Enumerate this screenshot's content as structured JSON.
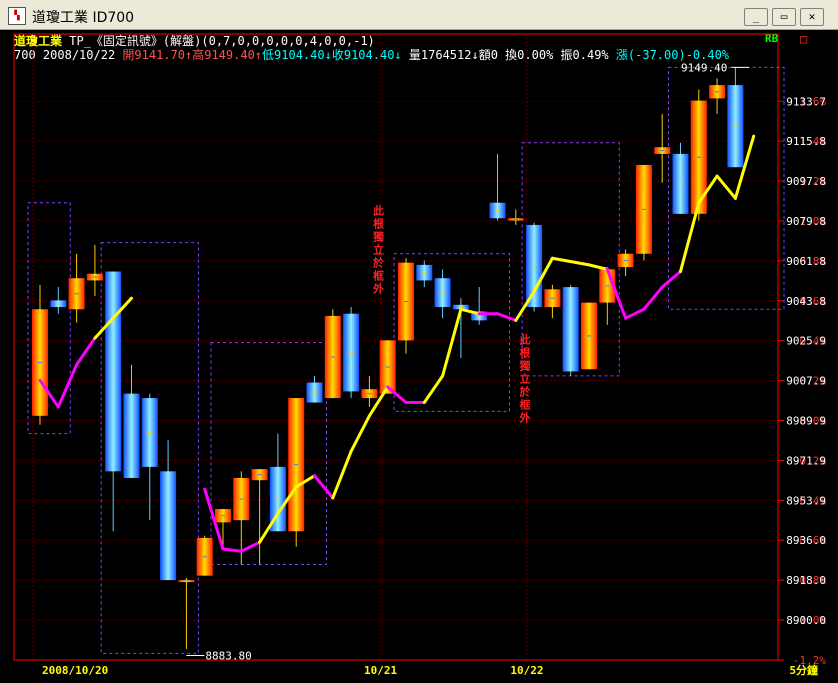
{
  "window": {
    "title": "道瓊工業 ID700",
    "icon": "chart-app-icon",
    "buttons": {
      "minimize": "_",
      "restore": "▭",
      "close": "✕"
    }
  },
  "header": {
    "name": "道瓊工業",
    "formula": "TP_《固定訊號》(解盤)(0,7,0,0,0,0,0,4,0,0,-1)",
    "code": "700",
    "date": "2008/10/22",
    "open": "開9141.70↑",
    "high": "高9149.40↑",
    "low": "低9104.40↓",
    "close": "收9104.40↓",
    "volume": "量1764512↓",
    "amount": "額0",
    "turnover": "換0.00%",
    "amplitude": "振0.49%",
    "change": "漲(-37.00)-0.40%",
    "rb_label": "RB",
    "box_label": "□"
  },
  "colors": {
    "up_outer": "#ff3000",
    "up_inner": "#ffcc00",
    "down_outer": "#1060ff",
    "down_inner": "#80e0ff",
    "line_up": "#ffff00",
    "line_down": "#ff00ff",
    "box": "#8040ff",
    "grid": "#800000",
    "axis": "#ff0000"
  },
  "chart_data": {
    "type": "candlestick",
    "interval": "5分鐘",
    "ylim": [
      8882,
      9155
    ],
    "y_ticks_price": [
      "9133.7",
      "9115.8",
      "9097.8",
      "9079.8",
      "9061.8",
      "9043.8",
      "9025.9",
      "9007.9",
      "8989.9",
      "8971.9",
      "8953.9",
      "8936.0",
      "8918.0",
      "8900.0"
    ],
    "y_ticks_pct": [
      "1.6%",
      "1.4%",
      "1.2%",
      "1.0%",
      "0.8%",
      "0.6%",
      "0.4%",
      "0.2%",
      "0.0%",
      "-0.2%",
      "-0.4%",
      "-0.6%",
      "-0.8%",
      "-1.0%",
      "-1.2%"
    ],
    "y_pct_values": [
      1.6,
      1.4,
      1.2,
      1.0,
      0.8,
      0.6,
      0.4,
      0.2,
      0.0,
      -0.2,
      -0.4,
      -0.6,
      -0.8,
      -1.0,
      -1.2
    ],
    "y_price_values": [
      9133.7,
      9115.8,
      9097.8,
      9079.8,
      9061.8,
      9043.8,
      9025.9,
      9007.9,
      8989.9,
      8971.9,
      8953.9,
      8936.0,
      8918.0,
      8900.0
    ],
    "base_price": 8989.9,
    "x_labels": [
      {
        "label": "2008/10/20",
        "index": 0
      },
      {
        "label": "10/21",
        "index": 19
      },
      {
        "label": "10/22",
        "index": 27
      }
    ],
    "candles": [
      {
        "o": 8992,
        "h": 9051,
        "l": 8988,
        "c": 9040
      },
      {
        "o": 9044,
        "h": 9050,
        "l": 9038,
        "c": 9041
      },
      {
        "o": 9040,
        "h": 9065,
        "l": 9034,
        "c": 9054
      },
      {
        "o": 9053,
        "h": 9069,
        "l": 9046,
        "c": 9056
      },
      {
        "o": 9057,
        "h": 9057,
        "l": 8940,
        "c": 8967
      },
      {
        "o": 9002,
        "h": 9015,
        "l": 8970,
        "c": 8964
      },
      {
        "o": 9000,
        "h": 9002,
        "l": 8945,
        "c": 8969
      },
      {
        "o": 8967,
        "h": 8981,
        "l": 8918,
        "c": 8918
      },
      {
        "o": 8918,
        "h": 8919,
        "l": 8887,
        "c": 8918
      },
      {
        "o": 8920,
        "h": 8938,
        "l": 8920,
        "c": 8937
      },
      {
        "o": 8944,
        "h": 8950,
        "l": 8932,
        "c": 8950
      },
      {
        "o": 8945,
        "h": 8967,
        "l": 8925,
        "c": 8964
      },
      {
        "o": 8963,
        "h": 8968,
        "l": 8925,
        "c": 8968
      },
      {
        "o": 8969,
        "h": 8984,
        "l": 8948,
        "c": 8940
      },
      {
        "o": 8940,
        "h": 9000,
        "l": 8933,
        "c": 9000
      },
      {
        "o": 9007,
        "h": 9010,
        "l": 8998,
        "c": 8998
      },
      {
        "o": 9000,
        "h": 9040,
        "l": 9000,
        "c": 9037
      },
      {
        "o": 9038,
        "h": 9041,
        "l": 9000,
        "c": 9003
      },
      {
        "o": 9000,
        "h": 9010,
        "l": 8996,
        "c": 9004
      },
      {
        "o": 9002,
        "h": 9026,
        "l": 9002,
        "c": 9026
      },
      {
        "o": 9026,
        "h": 9063,
        "l": 9020,
        "c": 9061
      },
      {
        "o": 9060,
        "h": 9062,
        "l": 9050,
        "c": 9053
      },
      {
        "o": 9054,
        "h": 9058,
        "l": 9036,
        "c": 9041
      },
      {
        "o": 9042,
        "h": 9045,
        "l": 9018,
        "c": 9040
      },
      {
        "o": 9039,
        "h": 9050,
        "l": 9033,
        "c": 9035
      },
      {
        "o": 9088,
        "h": 9110,
        "l": 9080,
        "c": 9081
      },
      {
        "o": 9080,
        "h": 9085,
        "l": 9078,
        "c": 9081
      },
      {
        "o": 9078,
        "h": 9079,
        "l": 9039,
        "c": 9041
      },
      {
        "o": 9041,
        "h": 9051,
        "l": 9036,
        "c": 9049
      },
      {
        "o": 9050,
        "h": 9051,
        "l": 9010,
        "c": 9012
      },
      {
        "o": 9013,
        "h": 9043,
        "l": 9013,
        "c": 9043
      },
      {
        "o": 9043,
        "h": 9059,
        "l": 9033,
        "c": 9058
      },
      {
        "o": 9059,
        "h": 9067,
        "l": 9055,
        "c": 9065
      },
      {
        "o": 9065,
        "h": 9105,
        "l": 9062,
        "c": 9105
      },
      {
        "o": 9110,
        "h": 9128,
        "l": 9097,
        "c": 9113
      },
      {
        "o": 9110,
        "h": 9115,
        "l": 9083,
        "c": 9083
      },
      {
        "o": 9083,
        "h": 9139,
        "l": 9080,
        "c": 9134
      },
      {
        "o": 9135,
        "h": 9144,
        "l": 9128,
        "c": 9141
      },
      {
        "o": 9141,
        "h": 9149,
        "l": 9104,
        "c": 9104
      }
    ],
    "signal_line": [
      {
        "i": 0,
        "v": 9008,
        "c": "down"
      },
      {
        "i": 1,
        "v": 8996,
        "c": "down"
      },
      {
        "i": 2,
        "v": 9015,
        "c": "down"
      },
      {
        "i": 3,
        "v": 9027,
        "c": "down"
      },
      {
        "i": 4,
        "v": 9036,
        "c": "up"
      },
      {
        "i": 5,
        "v": 9045,
        "c": "up"
      },
      {
        "i": 9,
        "v": 8959,
        "c": "up"
      },
      {
        "i": 10,
        "v": 8932,
        "c": "down"
      },
      {
        "i": 11,
        "v": 8931,
        "c": "down"
      },
      {
        "i": 12,
        "v": 8935,
        "c": "down"
      },
      {
        "i": 13,
        "v": 8948,
        "c": "up"
      },
      {
        "i": 14,
        "v": 8960,
        "c": "up"
      },
      {
        "i": 15,
        "v": 8965,
        "c": "up"
      },
      {
        "i": 16,
        "v": 8955,
        "c": "down"
      },
      {
        "i": 17,
        "v": 8976,
        "c": "up"
      },
      {
        "i": 18,
        "v": 8992,
        "c": "up"
      },
      {
        "i": 19,
        "v": 9005,
        "c": "up"
      },
      {
        "i": 20,
        "v": 8998,
        "c": "down"
      },
      {
        "i": 21,
        "v": 8998,
        "c": "down"
      },
      {
        "i": 22,
        "v": 9010,
        "c": "up"
      },
      {
        "i": 23,
        "v": 9040,
        "c": "up"
      },
      {
        "i": 24,
        "v": 9038,
        "c": "up"
      },
      {
        "i": 25,
        "v": 9038,
        "c": "down"
      },
      {
        "i": 26,
        "v": 9035,
        "c": "down"
      },
      {
        "i": 27,
        "v": 9048,
        "c": "up"
      },
      {
        "i": 28,
        "v": 9063,
        "c": "up"
      },
      {
        "i": 30,
        "v": 9060,
        "c": "up"
      },
      {
        "i": 31,
        "v": 9058,
        "c": "up"
      },
      {
        "i": 32,
        "v": 9036,
        "c": "down"
      },
      {
        "i": 33,
        "v": 9040,
        "c": "down"
      },
      {
        "i": 34,
        "v": 9050,
        "c": "down"
      },
      {
        "i": 35,
        "v": 9057,
        "c": "down"
      },
      {
        "i": 36,
        "v": 9088,
        "c": "up"
      },
      {
        "i": 37,
        "v": 9100,
        "c": "up"
      },
      {
        "i": 38,
        "v": 9090,
        "c": "up"
      },
      {
        "i": 39,
        "v": 9118,
        "c": "up"
      }
    ],
    "boxes": [
      {
        "from": 0,
        "to": 1,
        "top": 9088,
        "bottom": 8984
      },
      {
        "from": 4,
        "to": 8,
        "top": 9070,
        "bottom": 8885
      },
      {
        "from": 10,
        "to": 15,
        "top": 9025,
        "bottom": 8925
      },
      {
        "from": 20,
        "to": 25,
        "top": 9065,
        "bottom": 8994
      },
      {
        "from": 27,
        "to": 31,
        "top": 9115,
        "bottom": 9010
      },
      {
        "from": 35,
        "to": 40,
        "top": 9149,
        "bottom": 9040
      }
    ],
    "annotations": [
      {
        "text": "此根獨立於框外",
        "index": 18.5,
        "top": 9088
      },
      {
        "text": "此根獨立於框外",
        "index": 26.5,
        "top": 9030
      }
    ],
    "low_marker": {
      "text": "8883.80",
      "index": 8,
      "value": 8884
    },
    "high_marker": {
      "text": "9149.40",
      "index": 38,
      "value": 9149
    }
  }
}
